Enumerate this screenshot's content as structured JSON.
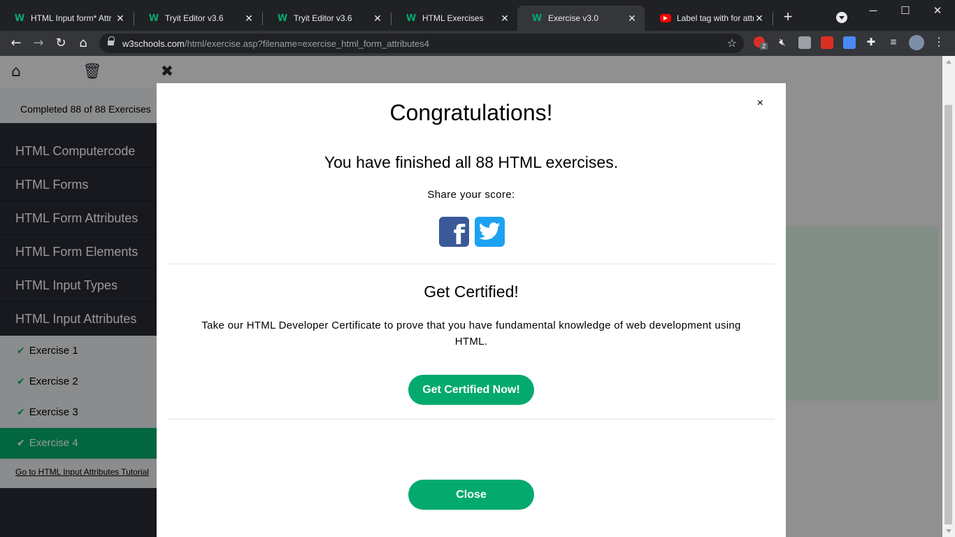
{
  "tabs": [
    {
      "title": "HTML Input form* Attr",
      "favicon": "w3schools-icon"
    },
    {
      "title": "Tryit Editor v3.6",
      "favicon": "w3schools-icon"
    },
    {
      "title": "Tryit Editor v3.6",
      "favicon": "w3schools-icon"
    },
    {
      "title": "HTML Exercises",
      "favicon": "w3schools-icon"
    },
    {
      "title": "Exercise v3.0",
      "favicon": "w3schools-icon",
      "active": true
    },
    {
      "title": "Label tag with for attri",
      "favicon": "youtube-icon"
    }
  ],
  "address": {
    "host": "w3schools.com",
    "path": "/html/exercise.asp?filename=exercise_html_form_attributes4"
  },
  "extension_badge": "2",
  "sidebar": {
    "progress": "Completed 88 of 88 Exercises",
    "topics": [
      "HTML Computercode",
      "HTML Forms",
      "HTML Form Attributes",
      "HTML Form Elements",
      "HTML Input Types",
      "HTML Input Attributes"
    ],
    "exercises": [
      "Exercise 1",
      "Exercise 2",
      "Exercise 3",
      "Exercise 4"
    ],
    "active_exercise": "Exercise 4",
    "tutorial_link": "Go to HTML Input Attributes Tutorial"
  },
  "modal": {
    "close_symbol": "×",
    "title": "Congratulations!",
    "subtitle": "You have finished all 88 HTML exercises.",
    "share_label": "Share your score:",
    "cert_title": "Get Certified!",
    "cert_description": "Take our HTML Developer Certificate to prove that you have fundamental knowledge of web development using HTML.",
    "cert_button": "Get Certified Now!",
    "close_button": "Close"
  },
  "colors": {
    "accent": "#04aa6d",
    "sidebar_bg": "#282a35",
    "facebook": "#3b5998",
    "twitter": "#1da1f2"
  }
}
